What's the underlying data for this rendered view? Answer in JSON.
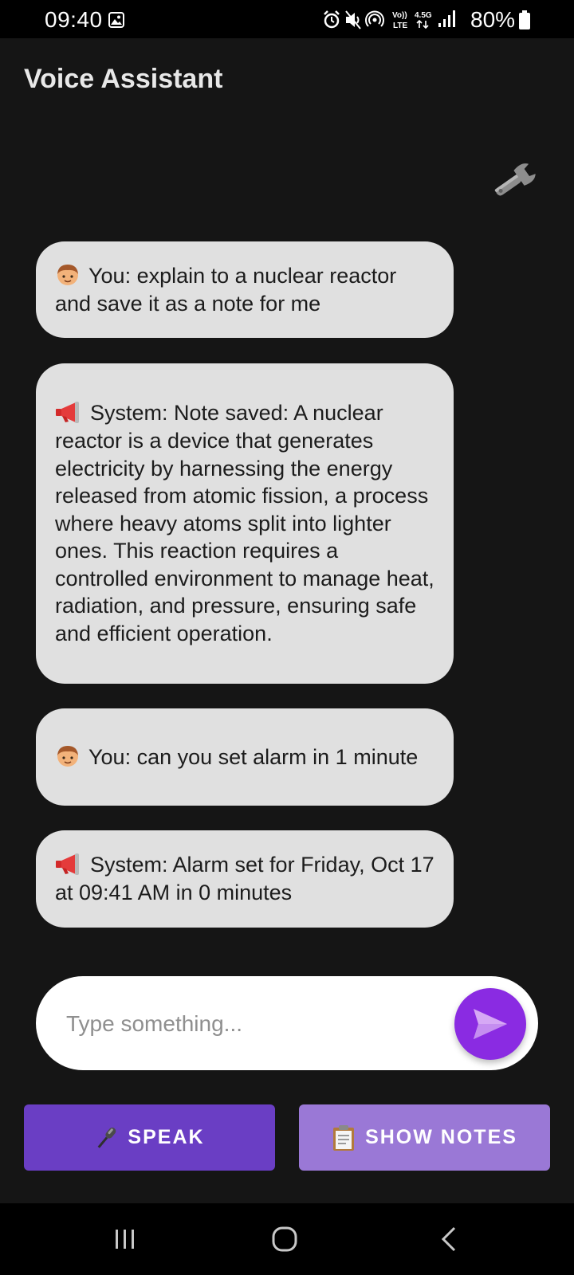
{
  "status_bar": {
    "time": "09:40",
    "network_volte": "Vo)) LTE",
    "network_type": "4.5G",
    "battery_percent": "80%"
  },
  "app": {
    "title": "Voice Assistant"
  },
  "messages": [
    {
      "sender": "You",
      "icon": "person-emoji-icon",
      "text": "You: explain to a nuclear reactor and save it as a note for me"
    },
    {
      "sender": "System",
      "icon": "megaphone-emoji-icon",
      "text": "System: Note saved: A nuclear reactor is a device that generates electricity by harnessing the energy released from atomic fission, a process where heavy atoms split into lighter ones. This reaction requires a controlled environment to manage heat, radiation, and pressure, ensuring safe and efficient operation."
    },
    {
      "sender": "You",
      "icon": "person-emoji-icon",
      "text": "You: can you set alarm in 1 minute"
    },
    {
      "sender": "System",
      "icon": "megaphone-emoji-icon",
      "text": "System: Alarm set for Friday, Oct 17 at 09:41 AM in 0 minutes"
    }
  ],
  "composer": {
    "placeholder": "Type something...",
    "value": ""
  },
  "actions": {
    "speak_label": "SPEAK",
    "notes_label": "SHOW NOTES"
  },
  "colors": {
    "background": "#151515",
    "bubble": "#e0e0e0",
    "send_button": "#8a2be2",
    "speak_button": "#6a3ec4",
    "notes_button": "#9a78d6"
  }
}
